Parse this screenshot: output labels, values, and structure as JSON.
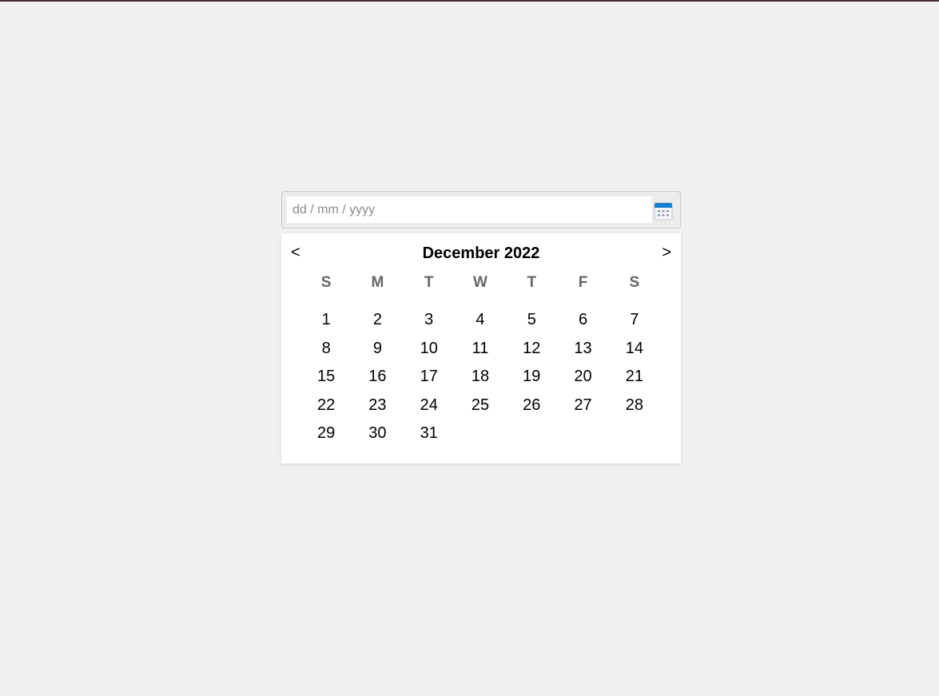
{
  "input": {
    "placeholder": "dd / mm / yyyy",
    "value": ""
  },
  "calendar_button": {
    "icon": "calendar-icon",
    "accent_color": "#1a7fd0"
  },
  "calendar": {
    "title": "December 2022",
    "prev_label": "<",
    "next_label": ">",
    "weekdays": [
      "S",
      "M",
      "T",
      "W",
      "T",
      "F",
      "S"
    ],
    "weeks": [
      [
        "1",
        "2",
        "3",
        "4",
        "5",
        "6",
        "7"
      ],
      [
        "8",
        "9",
        "10",
        "11",
        "12",
        "13",
        "14"
      ],
      [
        "15",
        "16",
        "17",
        "18",
        "19",
        "20",
        "21"
      ],
      [
        "22",
        "23",
        "24",
        "25",
        "26",
        "27",
        "28"
      ],
      [
        "29",
        "30",
        "31",
        "",
        "",
        "",
        ""
      ]
    ]
  }
}
